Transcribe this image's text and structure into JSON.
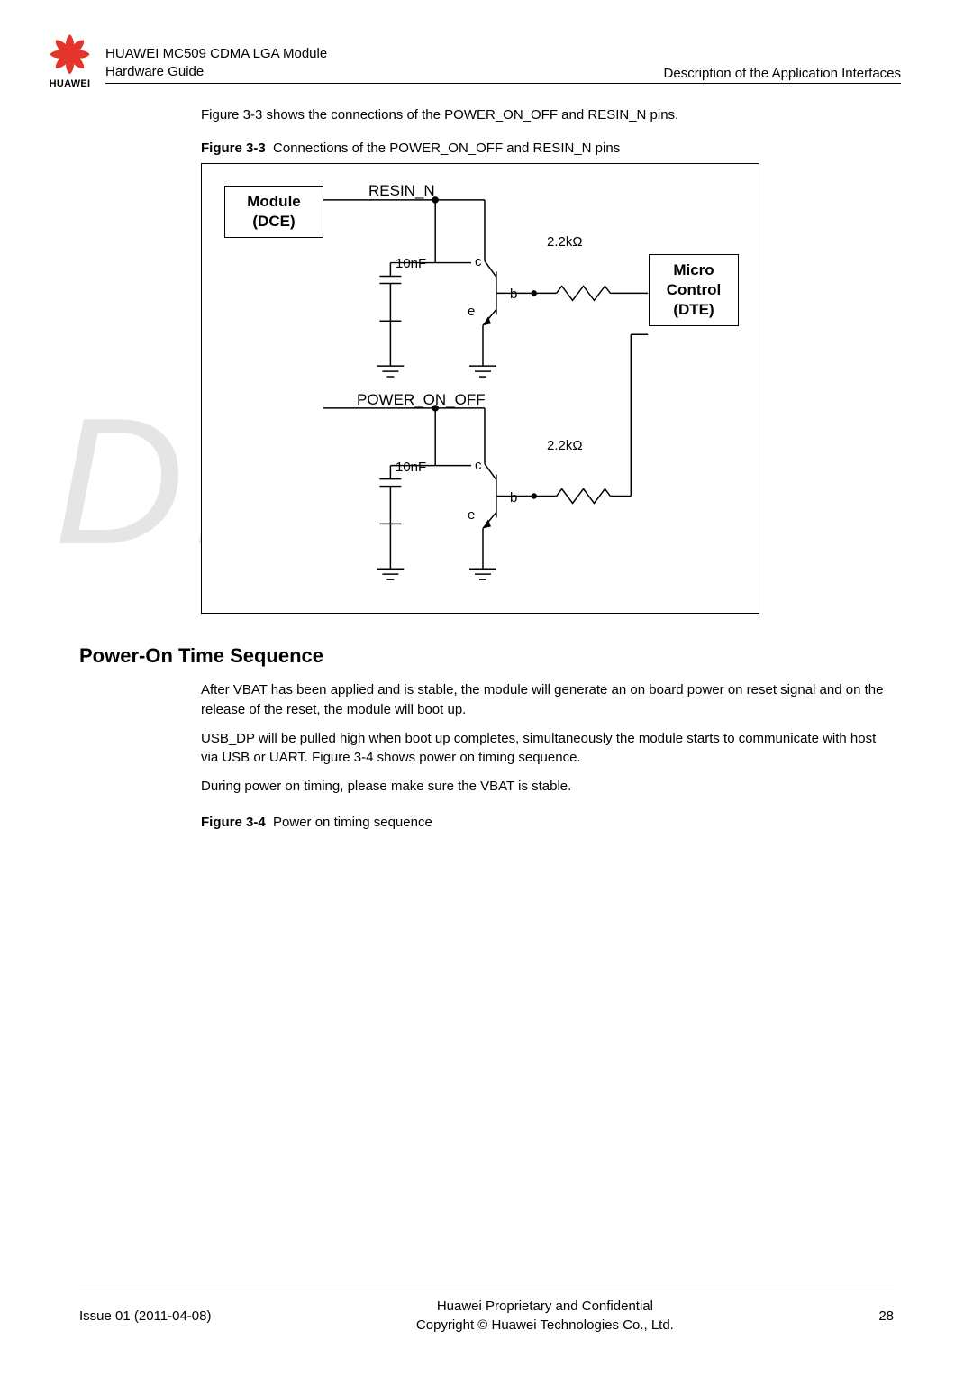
{
  "header": {
    "logo_text": "HUAWEI",
    "doc_title_1": "HUAWEI MC509 CDMA LGA Module",
    "doc_title_2": "Hardware Guide",
    "section_name": "Description of the Application Interfaces"
  },
  "intro_text": "Figure 3-3 shows the connections of the POWER_ON_OFF and RESIN_N pins.",
  "figure_3_3": {
    "number": "Figure 3-3",
    "caption": "Connections of the POWER_ON_OFF and RESIN_N pins"
  },
  "circuit": {
    "module_label_1": "Module",
    "module_label_2": "(DCE)",
    "micro_label_1": "Micro",
    "micro_label_2": "Control",
    "micro_label_3": "(DTE)",
    "signal_resin": "RESIN_N",
    "signal_power": "POWER_ON_OFF",
    "cap_label": "10nF",
    "res_label": "2.2kΩ",
    "node_c": "c",
    "node_b": "b",
    "node_e": "e"
  },
  "section_title": "Power-On Time Sequence",
  "paragraphs": {
    "p1": "After VBAT has been applied and is stable, the module will generate an on board power on reset signal and on the release of the reset, the module will boot up.",
    "p2": "USB_DP will be pulled high when boot up completes, simultaneously the module starts to communicate with host via USB or UART. Figure 3-4 shows power on timing sequence.",
    "p3": "During power on timing, please make sure the VBAT is stable."
  },
  "figure_3_4": {
    "number": "Figure 3-4",
    "caption": "Power on timing sequence"
  },
  "watermark": "DRAFT",
  "footer": {
    "issue": "Issue 01 (2011-04-08)",
    "line1": "Huawei Proprietary and Confidential",
    "line2": "Copyright © Huawei Technologies Co., Ltd.",
    "page": "28"
  }
}
